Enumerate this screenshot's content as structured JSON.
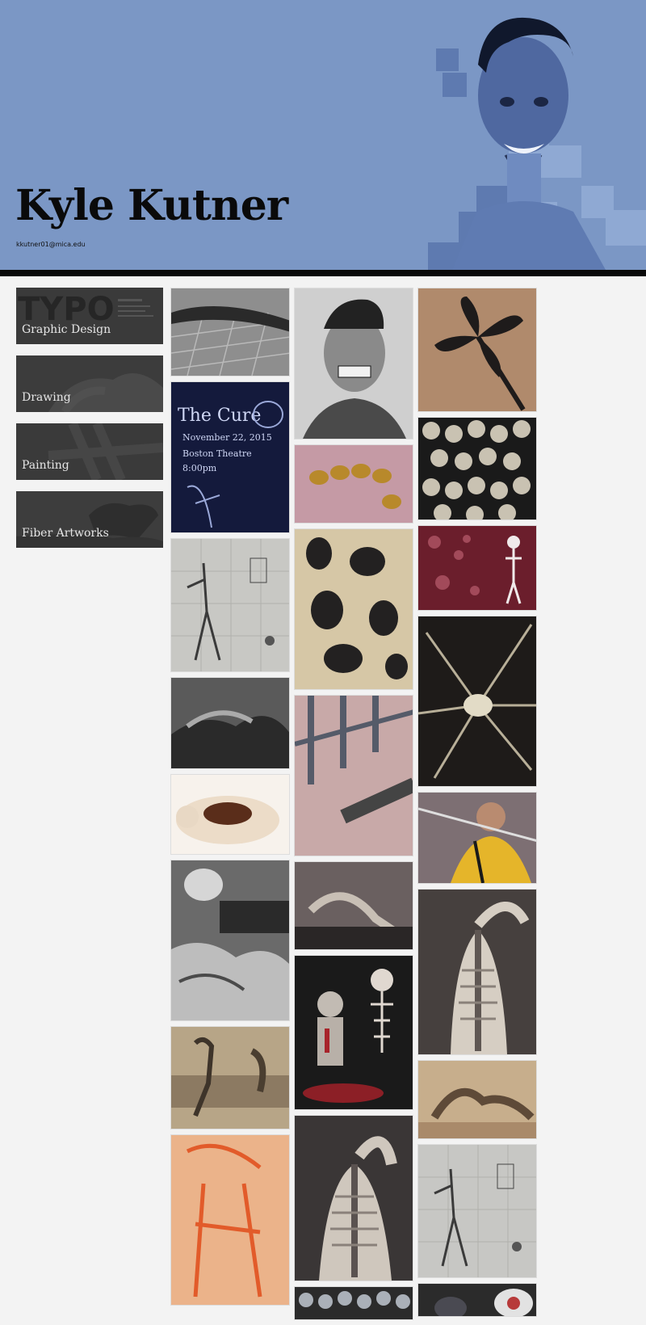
{
  "header": {
    "name": "Kyle Kutner",
    "email": "kkutner01@mica.edu",
    "background_color": "#7b97c5"
  },
  "nav": {
    "items": [
      {
        "label": "Graphic Design"
      },
      {
        "label": "Drawing"
      },
      {
        "label": "Painting"
      },
      {
        "label": "Fiber Artworks"
      }
    ]
  },
  "gallery": {
    "columns": [
      {
        "items": [
          {
            "subject": "charcoal drawing of figure lying on brick pavement",
            "palette": [
              "#555",
              "#aaa",
              "#222"
            ]
          },
          {
            "subject": "The Cure concert poster",
            "palette": [
              "#141a3c",
              "#9aa8d8",
              "#e8ecff"
            ]
          },
          {
            "subject": "drawing of anatomical figure dragging ball and chain",
            "palette": [
              "#c8c8c4",
              "#888",
              "#333"
            ]
          },
          {
            "subject": "charcoal drawing of crumpled cloth",
            "palette": [
              "#444",
              "#999",
              "#1a1a1a"
            ]
          },
          {
            "subject": "fiber sculpture of puffy figure with snakes",
            "palette": [
              "#efe3d3",
              "#8a4b2e",
              "#fff"
            ]
          },
          {
            "subject": "drawing of lamp and pillows on table",
            "palette": [
              "#5a5a5a",
              "#d0d0d0",
              "#222"
            ]
          },
          {
            "subject": "sepia drawing of two figures on couch",
            "palette": [
              "#8a7a64",
              "#c9b79a",
              "#3e342a"
            ]
          },
          {
            "subject": "orange chalk drawing of seated legs",
            "palette": [
              "#e9b48a",
              "#e2622e",
              "#f2d2b4"
            ]
          }
        ]
      },
      {
        "items": [
          {
            "subject": "charcoal self portrait grimacing",
            "palette": [
              "#cfcfcf",
              "#555",
              "#111"
            ]
          },
          {
            "subject": "painting of gold beads on pink cloth",
            "palette": [
              "#c79ba6",
              "#b8892b",
              "#6a3c1a"
            ]
          },
          {
            "subject": "painting of bone structure",
            "palette": [
              "#2c2a2a",
              "#d9c9a8",
              "#7a6c58"
            ]
          },
          {
            "subject": "painting of stair railing",
            "palette": [
              "#c8a9a8",
              "#555b69",
              "#e3d3cf"
            ]
          },
          {
            "subject": "drawing of reclining figure",
            "palette": [
              "#6a6060",
              "#b9b0a6",
              "#2a2626"
            ]
          },
          {
            "subject": "painting of man with skeleton",
            "palette": [
              "#1c1c1c",
              "#c7c0b8",
              "#a8242b"
            ]
          },
          {
            "subject": "painting of back with skeleton spine",
            "palette": [
              "#3a3636",
              "#cfc7bd",
              "#7b7470"
            ]
          },
          {
            "subject": "painting of cells",
            "palette": [
              "#1e1e1e",
              "#aab0b8",
              "#5c636c"
            ]
          }
        ]
      },
      {
        "items": [
          {
            "subject": "painting of dark flower on brown",
            "palette": [
              "#b08a6c",
              "#1e1b1b",
              "#6a554a"
            ]
          },
          {
            "subject": "painting of cellular pattern",
            "palette": [
              "#1a1a1a",
              "#d5cfc0",
              "#6e6a5e"
            ]
          },
          {
            "subject": "painting of skeleton in red bubbles",
            "palette": [
              "#6b1e2c",
              "#d9b6bb",
              "#f0eaea"
            ]
          },
          {
            "subject": "painting of neuron",
            "palette": [
              "#1e1b19",
              "#e2dbc6",
              "#6e6656"
            ]
          },
          {
            "subject": "painting of man with sword in yellow jacket",
            "palette": [
              "#7d6f73",
              "#e5b52a",
              "#2c2a2a"
            ]
          },
          {
            "subject": "painting of back with spine raised arm",
            "palette": [
              "#46403e",
              "#d6cec3",
              "#8a817a"
            ]
          },
          {
            "subject": "drawing of figure resting",
            "palette": [
              "#a98a6a",
              "#d9c3a2",
              "#5e4a38"
            ]
          },
          {
            "subject": "drawing of anatomical figure with ball and chain",
            "palette": [
              "#c7c7c4",
              "#888",
              "#333"
            ]
          },
          {
            "subject": "painting partially visible",
            "palette": [
              "#2b2b2b",
              "#e2e2e2",
              "#b73a3a"
            ]
          }
        ]
      }
    ]
  }
}
